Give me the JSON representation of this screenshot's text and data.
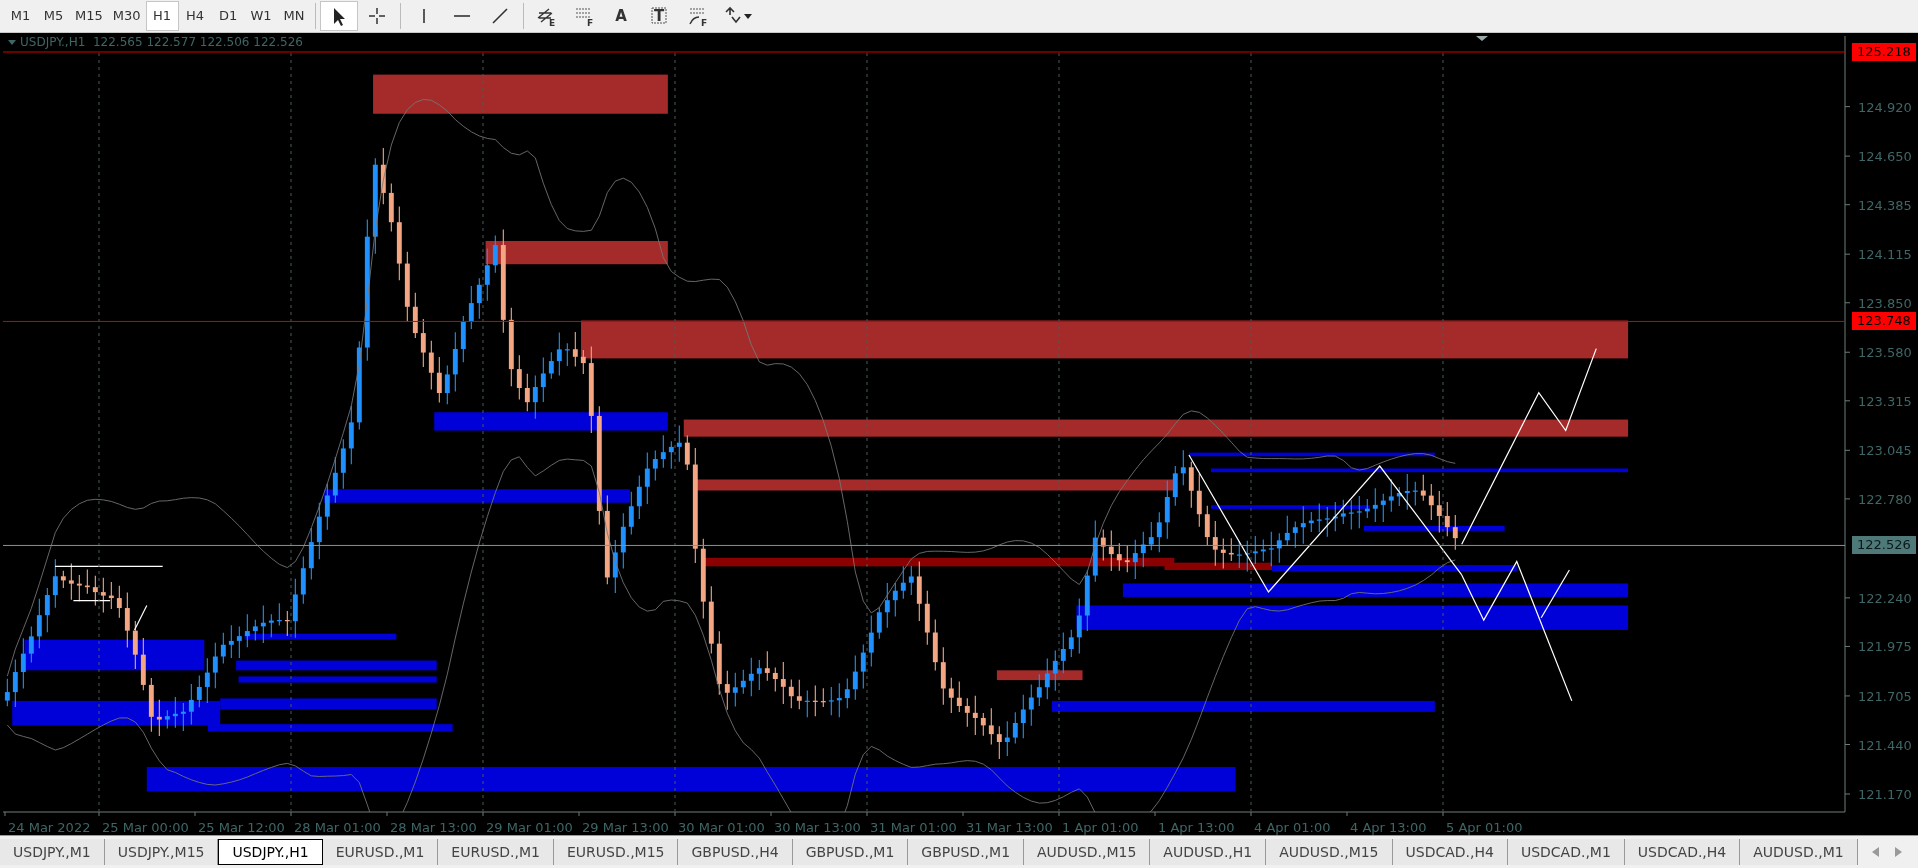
{
  "toolbar": {
    "timeframes": [
      {
        "label": "M1",
        "selected": false
      },
      {
        "label": "M5",
        "selected": false
      },
      {
        "label": "M15",
        "selected": false
      },
      {
        "label": "M30",
        "selected": false
      },
      {
        "label": "H1",
        "selected": true
      },
      {
        "label": "H4",
        "selected": false
      },
      {
        "label": "D1",
        "selected": false
      },
      {
        "label": "W1",
        "selected": false
      },
      {
        "label": "MN",
        "selected": false
      }
    ],
    "tools": [
      {
        "kind": "cursor",
        "selected": true
      },
      {
        "kind": "crosshair",
        "selected": false
      },
      {
        "kind": "vline",
        "selected": false
      },
      {
        "kind": "hline",
        "selected": false
      },
      {
        "kind": "trend",
        "selected": false
      },
      {
        "kind": "channel",
        "glyph": "E",
        "selected": false
      },
      {
        "kind": "fibo",
        "glyph": "F",
        "selected": false
      },
      {
        "kind": "text",
        "glyph": "A",
        "selected": false
      },
      {
        "kind": "label",
        "glyph": "T",
        "selected": false
      },
      {
        "kind": "fan",
        "glyph": "F",
        "selected": false
      },
      {
        "kind": "arrows",
        "selected": false
      }
    ]
  },
  "chart": {
    "header": "USDJPY.,H1  122.565 122.577 122.506 122.526",
    "price_ticks": [
      "124.920",
      "124.650",
      "124.385",
      "124.115",
      "123.850",
      "123.580",
      "123.315",
      "123.045",
      "122.780",
      "122.240",
      "121.975",
      "121.705",
      "121.440",
      "121.170"
    ],
    "price_markers": [
      {
        "text": "125.218",
        "kind": "level"
      },
      {
        "text": "123.748",
        "kind": "level"
      },
      {
        "text": "122.526",
        "kind": "bid"
      }
    ],
    "time_labels": [
      "24 Mar 2022",
      "25 Mar 00:00",
      "25 Mar 12:00",
      "28 Mar 01:00",
      "28 Mar 13:00",
      "29 Mar 01:00",
      "29 Mar 13:00",
      "30 Mar 01:00",
      "30 Mar 13:00",
      "31 Mar 01:00",
      "31 Mar 13:00",
      "1 Apr 01:00",
      "1 Apr 13:00",
      "4 Apr 01:00",
      "4 Apr 13:00",
      "5 Apr 01:00"
    ]
  },
  "tabs": [
    {
      "label": "USDJPY.,M1",
      "selected": false
    },
    {
      "label": "USDJPY.,M15",
      "selected": false
    },
    {
      "label": "USDJPY.,H1",
      "selected": true
    },
    {
      "label": "EURUSD.,M1",
      "selected": false
    },
    {
      "label": "EURUSD.,M1",
      "selected": false
    },
    {
      "label": "EURUSD.,M15",
      "selected": false
    },
    {
      "label": "GBPUSD.,H4",
      "selected": false
    },
    {
      "label": "GBPUSD.,M1",
      "selected": false
    },
    {
      "label": "GBPUSD.,M1",
      "selected": false
    },
    {
      "label": "AUDUSD.,M15",
      "selected": false
    },
    {
      "label": "AUDUSD.,H1",
      "selected": false
    },
    {
      "label": "AUDUSD.,M15",
      "selected": false
    },
    {
      "label": "USDCAD.,H4",
      "selected": false
    },
    {
      "label": "USDCAD.,M1",
      "selected": false
    },
    {
      "label": "USDCAD.,H4",
      "selected": false
    },
    {
      "label": "AUDUSD.,M1",
      "selected": false
    }
  ]
}
